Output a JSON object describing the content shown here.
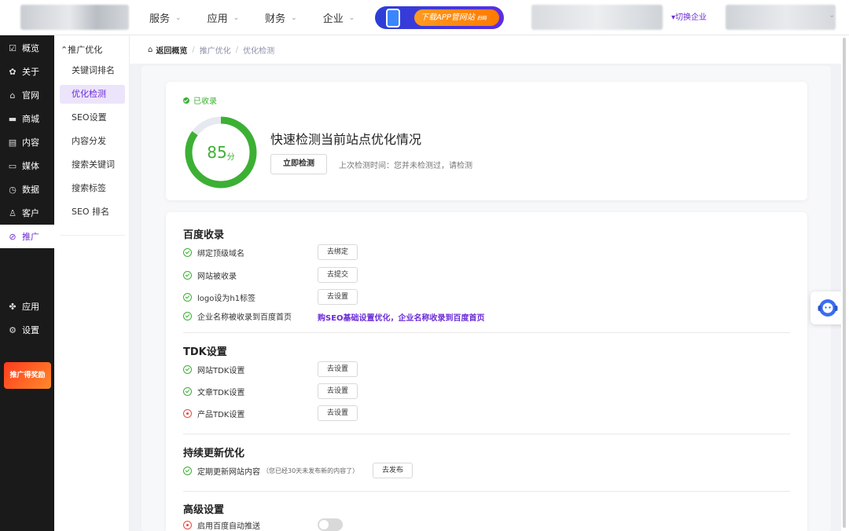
{
  "topbar": {
    "nav": [
      {
        "label": "服务",
        "chevron": "⌄"
      },
      {
        "label": "应用",
        "chevron": "⌄"
      },
      {
        "label": "财务",
        "chevron": "⌄"
      },
      {
        "label": "企业",
        "chevron": "⌄"
      }
    ],
    "app_download": {
      "label": "下载APP管网站",
      "badge": "扫码"
    },
    "switch_enterprise": "▾切换企业"
  },
  "sidebar": {
    "items": [
      {
        "icon": "overview-icon",
        "glyph": "☑",
        "label": "概览"
      },
      {
        "icon": "gear-icon",
        "glyph": "✿",
        "label": "关于"
      },
      {
        "icon": "home-icon",
        "glyph": "⌂",
        "label": "官网"
      },
      {
        "icon": "shop-icon",
        "glyph": "▬",
        "label": "商城"
      },
      {
        "icon": "document-icon",
        "glyph": "▤",
        "label": "内容"
      },
      {
        "icon": "media-icon",
        "glyph": "▭",
        "label": "媒体"
      },
      {
        "icon": "clock-icon",
        "glyph": "◷",
        "label": "数据"
      },
      {
        "icon": "user-icon",
        "glyph": "♙",
        "label": "客户"
      },
      {
        "icon": "link-icon",
        "glyph": "⊘",
        "label": "推广"
      }
    ],
    "bottom_items": [
      {
        "icon": "apps-icon",
        "glyph": "✤",
        "label": "应用"
      },
      {
        "icon": "settings-icon",
        "glyph": "⚙",
        "label": "设置"
      }
    ],
    "promo": "推广得奖励"
  },
  "subnav": {
    "header": "⌃推广优化",
    "items": [
      "关键词排名",
      "优化检测",
      "SEO设置",
      "内容分发",
      "搜索关键词",
      "搜索标签",
      "SEO 排名"
    ]
  },
  "breadcrumb": {
    "back": "返回概览",
    "items": [
      "推广优化",
      "优化检测"
    ],
    "separator": "/"
  },
  "summary": {
    "status": "已收录",
    "score": 85,
    "score_unit": "分",
    "score_max": 100,
    "title": "快速检测当前站点优化情况",
    "check_button": "立即检测",
    "last_check": "上次检测时间：您并未检测过，请检测"
  },
  "sections": [
    {
      "title": "百度收录",
      "items": [
        {
          "label": "绑定顶级域名",
          "status": "ok",
          "action": "去绑定"
        },
        {
          "label": "网站被收录",
          "status": "ok",
          "action": "去提交"
        },
        {
          "label": "logo设为h1标签",
          "status": "ok",
          "action": "去设置"
        },
        {
          "label": "企业名称被收录到百度首页",
          "status": "ok",
          "link": "购SEO基础设置优化，企业名称收录到百度首页"
        }
      ]
    },
    {
      "title": "TDK设置",
      "items": [
        {
          "label": "网站TDK设置",
          "status": "ok",
          "action": "去设置"
        },
        {
          "label": "文章TDK设置",
          "status": "ok",
          "action": "去设置"
        },
        {
          "label": "产品TDK设置",
          "status": "error",
          "action": "去设置"
        }
      ]
    },
    {
      "title": "持续更新优化",
      "items": [
        {
          "label": "定期更新网站内容",
          "note": "（您已经30天未发布新的内容了）",
          "status": "ok",
          "action": "去发布"
        }
      ]
    },
    {
      "title": "高级设置",
      "items": [
        {
          "label": "启用百度自动推送",
          "status": "error",
          "toggle": false
        }
      ]
    }
  ],
  "colors": {
    "accent": "#6b2bd6",
    "success": "#3cb034",
    "error": "#e84a3c"
  }
}
